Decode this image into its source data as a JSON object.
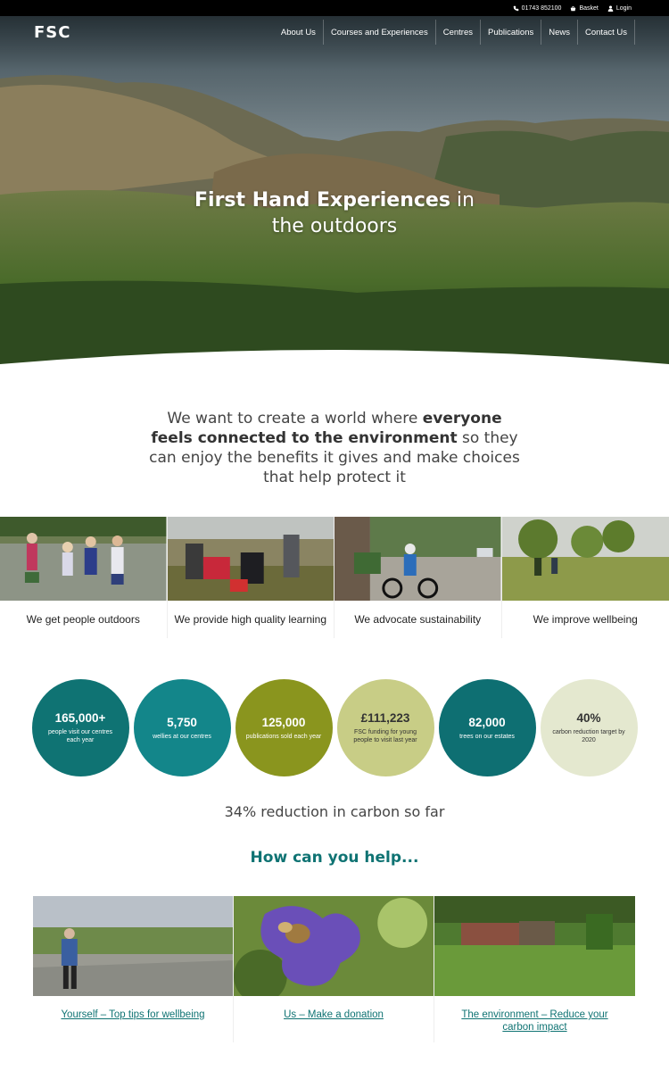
{
  "utility": {
    "phone": "01743 852100",
    "basket": "Basket",
    "login": "Login"
  },
  "header": {
    "logo": "FSC",
    "nav": [
      "About Us",
      "Courses and Experiences",
      "Centres",
      "Publications",
      "News",
      "Contact Us"
    ]
  },
  "hero": {
    "title_bold": "First Hand Experiences",
    "title_rest": " in",
    "title_line2": "the outdoors"
  },
  "mission": {
    "part1": "We want to create a world where ",
    "bold": "everyone feels connected to the environment",
    "part2": " so they can enjoy the benefits it gives and make choices that help protect it"
  },
  "pillars": [
    {
      "caption": "We get people outdoors"
    },
    {
      "caption": "We provide high quality learning"
    },
    {
      "caption": "We advocate sustainability"
    },
    {
      "caption": "We improve wellbeing"
    }
  ],
  "stats": [
    {
      "value": "165,000+",
      "label": "people visit our centres each year",
      "color": "#0f7373"
    },
    {
      "value": "5,750",
      "label": "wellies at our centres",
      "color": "#13868a"
    },
    {
      "value": "125,000",
      "label": "publications sold each year",
      "color": "#8a951e"
    },
    {
      "value": "£111,223",
      "label": "FSC funding for young people to visit last year",
      "color": "#c8cd86"
    },
    {
      "value": "82,000",
      "label": "trees on our estates",
      "color": "#0e6f72"
    },
    {
      "value": "40%",
      "label": "carbon reduction target by 2020",
      "color": "#e4e8cf"
    }
  ],
  "carbon_text": "34% reduction in carbon so far",
  "help": {
    "title": "How can you help...",
    "items": [
      {
        "link": "Yourself – Top tips for wellbeing"
      },
      {
        "link": "Us – Make a donation"
      },
      {
        "link": "The environment – Reduce your carbon impact"
      }
    ]
  },
  "colors": {
    "teal": "#0f7373",
    "olive": "#8a951e"
  }
}
